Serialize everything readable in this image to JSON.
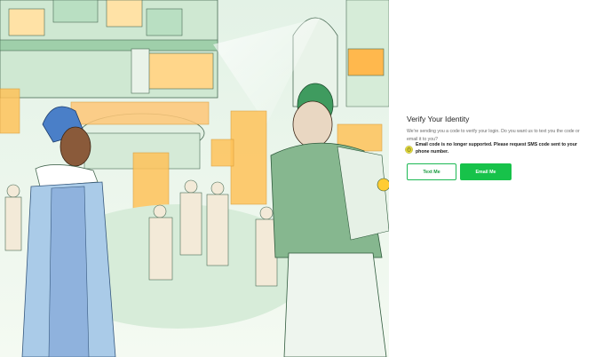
{
  "verify": {
    "title": "Verify Your Identity",
    "description": "We're sending you a code to verify your login. Do you want us to text you the code or email it to you?",
    "notice": "Email code is no longer supported. Please request SMS code sent to your phone number.",
    "text_me_label": "Text Me",
    "email_me_label": "Email Me"
  },
  "colors": {
    "primary_green": "#17c24a",
    "notice_yellow": "#e8e040"
  },
  "icons": {
    "notice": "warning-circle-icon"
  }
}
